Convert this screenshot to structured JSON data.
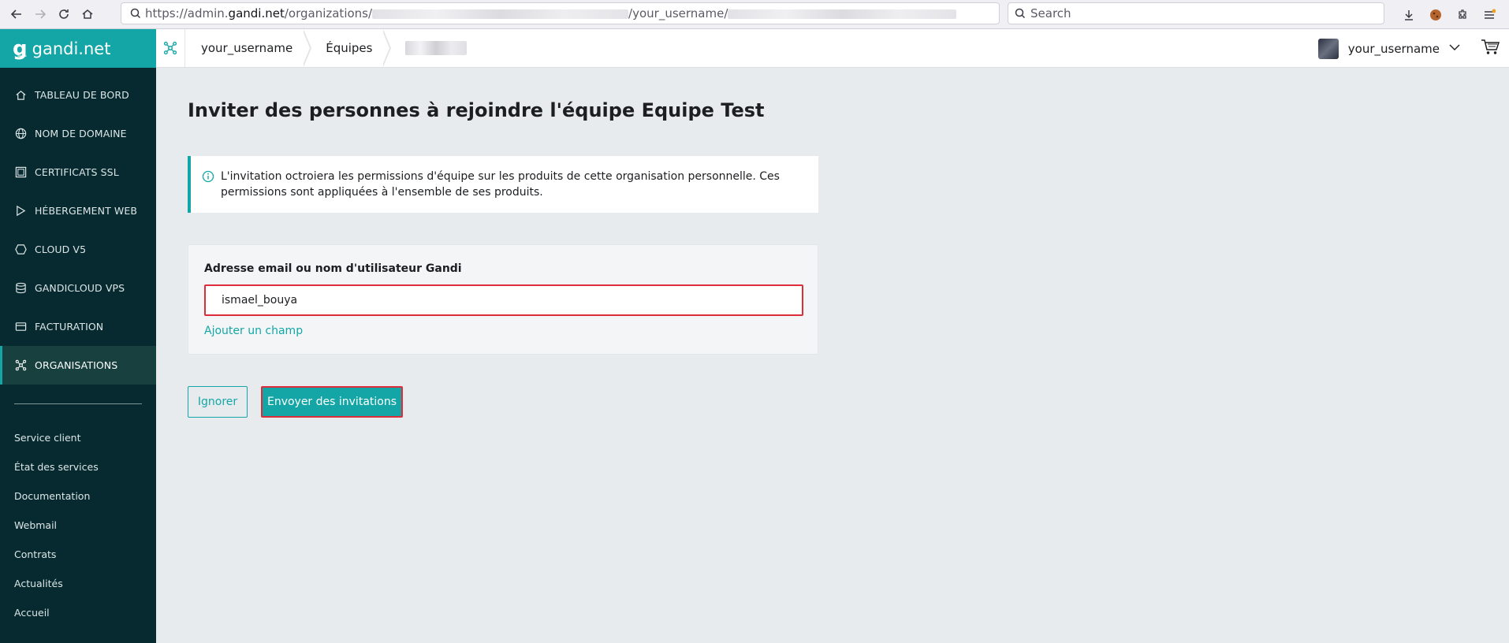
{
  "browser": {
    "url_prefix": "https://admin.",
    "url_domain": "gandi.net",
    "url_path": "/organizations/",
    "url_middle": "/your_username/",
    "search_placeholder": "Search"
  },
  "brand": {
    "logo_text": "gandi.net"
  },
  "sidebar": {
    "items": [
      {
        "label": "TABLEAU DE BORD",
        "icon": "home-icon"
      },
      {
        "label": "NOM DE DOMAINE",
        "icon": "globe-icon"
      },
      {
        "label": "CERTIFICATS SSL",
        "icon": "certificate-icon"
      },
      {
        "label": "HÉBERGEMENT WEB",
        "icon": "play-icon"
      },
      {
        "label": "CLOUD V5",
        "icon": "hexagon-icon"
      },
      {
        "label": "GANDICLOUD VPS",
        "icon": "server-icon"
      },
      {
        "label": "FACTURATION",
        "icon": "credit-card-icon"
      },
      {
        "label": "ORGANISATIONS",
        "icon": "network-icon"
      }
    ],
    "links": [
      "Service client",
      "État des services",
      "Documentation",
      "Webmail",
      "Contrats",
      "Actualités",
      "Accueil"
    ]
  },
  "topbar": {
    "crumbs": [
      "your_username",
      "Équipes"
    ],
    "username": "your_username"
  },
  "main": {
    "title": "Inviter des personnes à rejoindre l'équipe Equipe Test",
    "info_text": "L'invitation octroiera les permissions d'équipe sur les produits de cette organisation personnelle. Ces permissions sont appliquées à l'ensemble de ses produits.",
    "field_label": "Adresse email ou nom d'utilisateur Gandi",
    "field_value": "ismael_bouya",
    "add_field_label": "Ajouter un champ",
    "ignore_label": "Ignorer",
    "send_label": "Envoyer des invitations"
  },
  "colors": {
    "accent": "#14a6a6",
    "sidebar_bg": "#062a2f",
    "highlight_border": "#dd2c3a"
  }
}
